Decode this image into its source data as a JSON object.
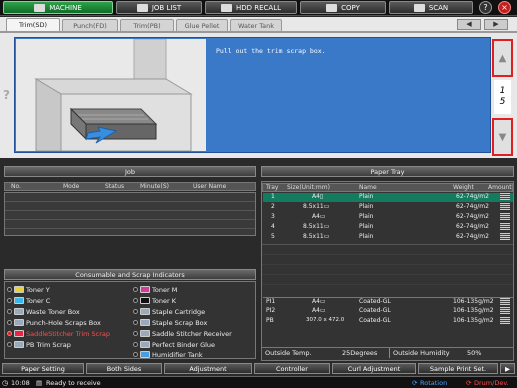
{
  "topbar": {
    "machine": "MACHINE",
    "job_list": "JOB LIST",
    "hdd_recall": "HDD RECALL",
    "copy": "COPY",
    "scan": "SCAN",
    "help": "?",
    "stop": "×"
  },
  "tabs": [
    "Trim(SD)",
    "Punch(FD)",
    "Trim(PB)",
    "Glue Pellet",
    "Water Tank"
  ],
  "guide": {
    "message": "Pull out the trim scrap box.",
    "page_current": "1",
    "page_total": "5"
  },
  "job": {
    "title": "Job",
    "columns": [
      "No.",
      "Mode",
      "Status",
      "Minute(S)",
      "User Name"
    ]
  },
  "consumables": {
    "title": "Consumable and Scrap Indicators",
    "left": [
      "Toner Y",
      "Toner C",
      "Waste Toner Box",
      "Punch-Hole Scraps Box",
      "SaddleStitcher Trim Scrap",
      "PB Trim Scrap"
    ],
    "right": [
      "Toner M",
      "Toner K",
      "Staple Cartridge",
      "Staple Scrap Box",
      "Saddle Stitcher Receiver",
      "Perfect Binder Glue",
      "Humidifier Tank"
    ]
  },
  "paper_tray": {
    "title": "Paper Tray",
    "columns": [
      "Tray",
      "Size(Unit:mm)",
      "Name",
      "Weight",
      "Amount"
    ],
    "rows": [
      {
        "tray": "1",
        "size": "A4▯",
        "name": "Plain",
        "weight": "62-74g/m2"
      },
      {
        "tray": "2",
        "size": "8.5x11▭",
        "name": "Plain",
        "weight": "62-74g/m2"
      },
      {
        "tray": "3",
        "size": "A4▭",
        "name": "Plain",
        "weight": "62-74g/m2"
      },
      {
        "tray": "4",
        "size": "8.5x11▭",
        "name": "Plain",
        "weight": "62-74g/m2"
      },
      {
        "tray": "5",
        "size": "8.5x11▭",
        "name": "Plain",
        "weight": "62-74g/m2"
      }
    ],
    "pi_rows": [
      {
        "tray": "PI1",
        "size": "A4▭",
        "name": "Coated-GL",
        "weight": "106-135g/m2"
      },
      {
        "tray": "PI2",
        "size": "A4▭",
        "name": "Coated-GL",
        "weight": "106-135g/m2"
      },
      {
        "tray": "PB",
        "size": "307.0 x 472.0",
        "name": "Coated-GL",
        "weight": "106-135g/m2"
      }
    ],
    "outside_temp_label": "Outside Temp.",
    "outside_temp_value": "25Degrees",
    "outside_humidity_label": "Outside Humidity",
    "outside_humidity_value": "50%"
  },
  "bottom_tabs": [
    "Paper Setting",
    "Both Sides",
    "Adjustment",
    "Controller",
    "Curl Adjustment",
    "Sample Print Set."
  ],
  "status": {
    "time": "10:08",
    "message": "Ready to receive",
    "rotation": "Rotation",
    "drum": "Drum/Dev."
  },
  "colors": {
    "active_green": "#2fa34a",
    "guide_blue": "#3a78c8",
    "highlight_red": "#e02020",
    "tray_selected": "#137b5f"
  }
}
